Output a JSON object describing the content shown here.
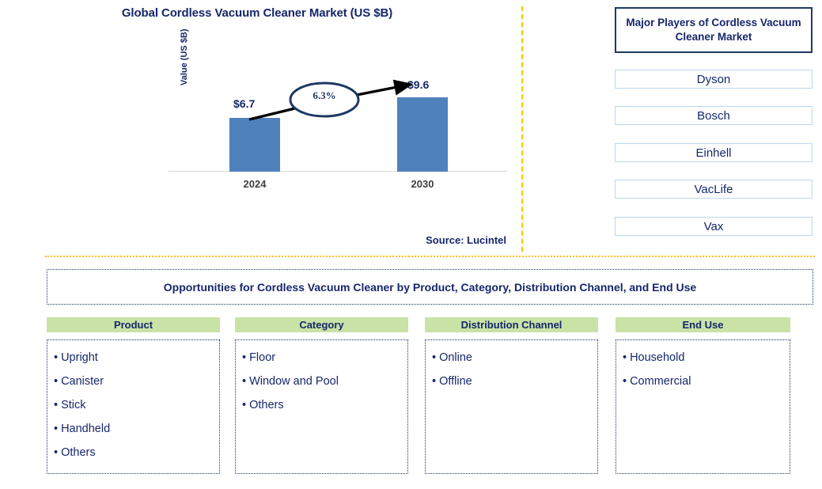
{
  "chart_panel": {
    "title": "Global Cordless Vacuum Cleaner Market (US $B)",
    "y_axis_label": "Value (US $B)",
    "source": "Source: Lucintel"
  },
  "chart_data": {
    "type": "bar",
    "title": "Global Cordless Vacuum Cleaner Market (US $B)",
    "categories": [
      "2024",
      "2030"
    ],
    "values": [
      6.7,
      9.6
    ],
    "data_labels": [
      "$6.7",
      "$9.6"
    ],
    "xlabel": "",
    "ylabel": "Value (US $B)",
    "ylim": [
      0,
      11
    ],
    "grid": false,
    "legend": "none",
    "series_color": "#4F81BD",
    "annotations": [
      {
        "type": "cagr-callout",
        "label": "6.3%",
        "from": "2024",
        "to": "2030",
        "shape": "ellipse-with-arrow"
      }
    ],
    "source": "Source: Lucintel"
  },
  "players_panel": {
    "title": "Major Players of Cordless Vacuum Cleaner Market",
    "items": [
      {
        "label": "Dyson"
      },
      {
        "label": "Bosch"
      },
      {
        "label": "Einhell"
      },
      {
        "label": "VacLife"
      },
      {
        "label": "Vax"
      }
    ]
  },
  "opportunities": {
    "banner": "Opportunities for Cordless Vacuum Cleaner by Product, Category, Distribution Channel, and End Use",
    "bullet": "•",
    "columns": [
      {
        "header": "Product",
        "items": [
          "Upright",
          "Canister",
          "Stick",
          "Handheld",
          "Others"
        ]
      },
      {
        "header": "Category",
        "items": [
          "Floor",
          "Window and Pool",
          "Others"
        ]
      },
      {
        "header": "Distribution Channel",
        "items": [
          "Online",
          "Offline"
        ]
      },
      {
        "header": "End Use",
        "items": [
          "Household",
          "Commercial"
        ]
      }
    ]
  },
  "colors": {
    "bar": "#4F81BD",
    "navy_text": "#16276B",
    "divider": "#FFC000",
    "header_green": "#C9E2A6",
    "player_border": "#BDD7EE"
  }
}
